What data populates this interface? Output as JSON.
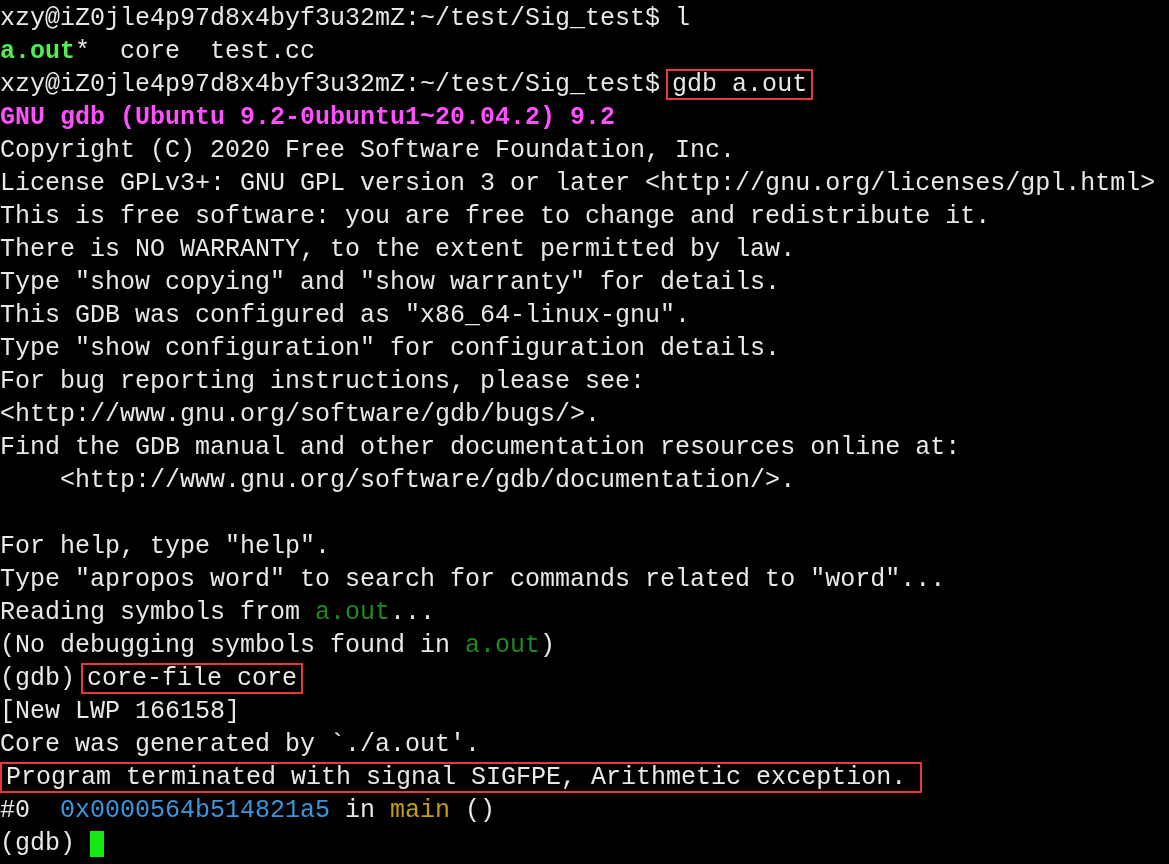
{
  "terminal": {
    "lines": [
      {
        "segments": [
          {
            "kind": "text",
            "text": "xzy@iZ0jle4p97d8x4byf3u32mZ:~/test/Sig_test$ l"
          }
        ]
      },
      {
        "segments": [
          {
            "kind": "exec",
            "text": "a.out"
          },
          {
            "kind": "text",
            "text": "*  core  test.cc"
          }
        ]
      },
      {
        "segments": [
          {
            "kind": "text",
            "text": "xzy@iZ0jle4p97d8x4byf3u32mZ:~/test/Sig_test$"
          },
          {
            "kind": "text",
            "text": "gdb a.out",
            "boxed": true
          }
        ]
      },
      {
        "segments": [
          {
            "kind": "banner",
            "text": "GNU gdb (Ubuntu 9.2-0ubuntu1~20.04.2) 9.2"
          }
        ]
      },
      {
        "segments": [
          {
            "kind": "text",
            "text": "Copyright (C) 2020 Free Software Foundation, Inc."
          }
        ]
      },
      {
        "segments": [
          {
            "kind": "text",
            "text": "License GPLv3+: GNU GPL version 3 or later <http://gnu.org/licenses/gpl.html>"
          }
        ]
      },
      {
        "segments": [
          {
            "kind": "text",
            "text": "This is free software: you are free to change and redistribute it."
          }
        ]
      },
      {
        "segments": [
          {
            "kind": "text",
            "text": "There is NO WARRANTY, to the extent permitted by law."
          }
        ]
      },
      {
        "segments": [
          {
            "kind": "text",
            "text": "Type \"show copying\" and \"show warranty\" for details."
          }
        ]
      },
      {
        "segments": [
          {
            "kind": "text",
            "text": "This GDB was configured as \"x86_64-linux-gnu\"."
          }
        ]
      },
      {
        "segments": [
          {
            "kind": "text",
            "text": "Type \"show configuration\" for configuration details."
          }
        ]
      },
      {
        "segments": [
          {
            "kind": "text",
            "text": "For bug reporting instructions, please see:"
          }
        ]
      },
      {
        "segments": [
          {
            "kind": "text",
            "text": "<http://www.gnu.org/software/gdb/bugs/>."
          }
        ]
      },
      {
        "segments": [
          {
            "kind": "text",
            "text": "Find the GDB manual and other documentation resources online at:"
          }
        ]
      },
      {
        "segments": [
          {
            "kind": "text",
            "text": "    <http://www.gnu.org/software/gdb/documentation/>."
          }
        ]
      },
      {
        "blank_line_before": true,
        "segments": [
          {
            "kind": "text",
            "text": "For help, type \"help\"."
          }
        ]
      },
      {
        "segments": [
          {
            "kind": "text",
            "text": "Type \"apropos word\" to search for commands related to \"word\"..."
          }
        ]
      },
      {
        "segments": [
          {
            "kind": "text",
            "text": "Reading symbols from "
          },
          {
            "kind": "file",
            "text": "a.out"
          },
          {
            "kind": "text",
            "text": "..."
          }
        ]
      },
      {
        "segments": [
          {
            "kind": "text",
            "text": "(No debugging symbols found in "
          },
          {
            "kind": "file",
            "text": "a.out"
          },
          {
            "kind": "text",
            "text": ")"
          }
        ]
      },
      {
        "segments": [
          {
            "kind": "text",
            "text": "(gdb)"
          },
          {
            "kind": "text",
            "text": "core-file core",
            "boxed": true
          }
        ]
      },
      {
        "segments": [
          {
            "kind": "text",
            "text": "[New LWP 166158]"
          }
        ]
      },
      {
        "segments": [
          {
            "kind": "text",
            "text": "Core was generated by `./a.out'."
          }
        ]
      },
      {
        "segments": [
          {
            "kind": "text",
            "text": "Program terminated with signal SIGFPE, Arithmetic exception.",
            "boxed": true
          }
        ]
      },
      {
        "segments": [
          {
            "kind": "text",
            "text": "#0  "
          },
          {
            "kind": "address",
            "text": "0x0000564b514821a5"
          },
          {
            "kind": "text",
            "text": " in "
          },
          {
            "kind": "function",
            "text": "main"
          },
          {
            "kind": "text",
            "text": " ()"
          }
        ]
      },
      {
        "segments": [
          {
            "kind": "text",
            "text": "(gdb) "
          }
        ],
        "cursor": true
      }
    ]
  }
}
